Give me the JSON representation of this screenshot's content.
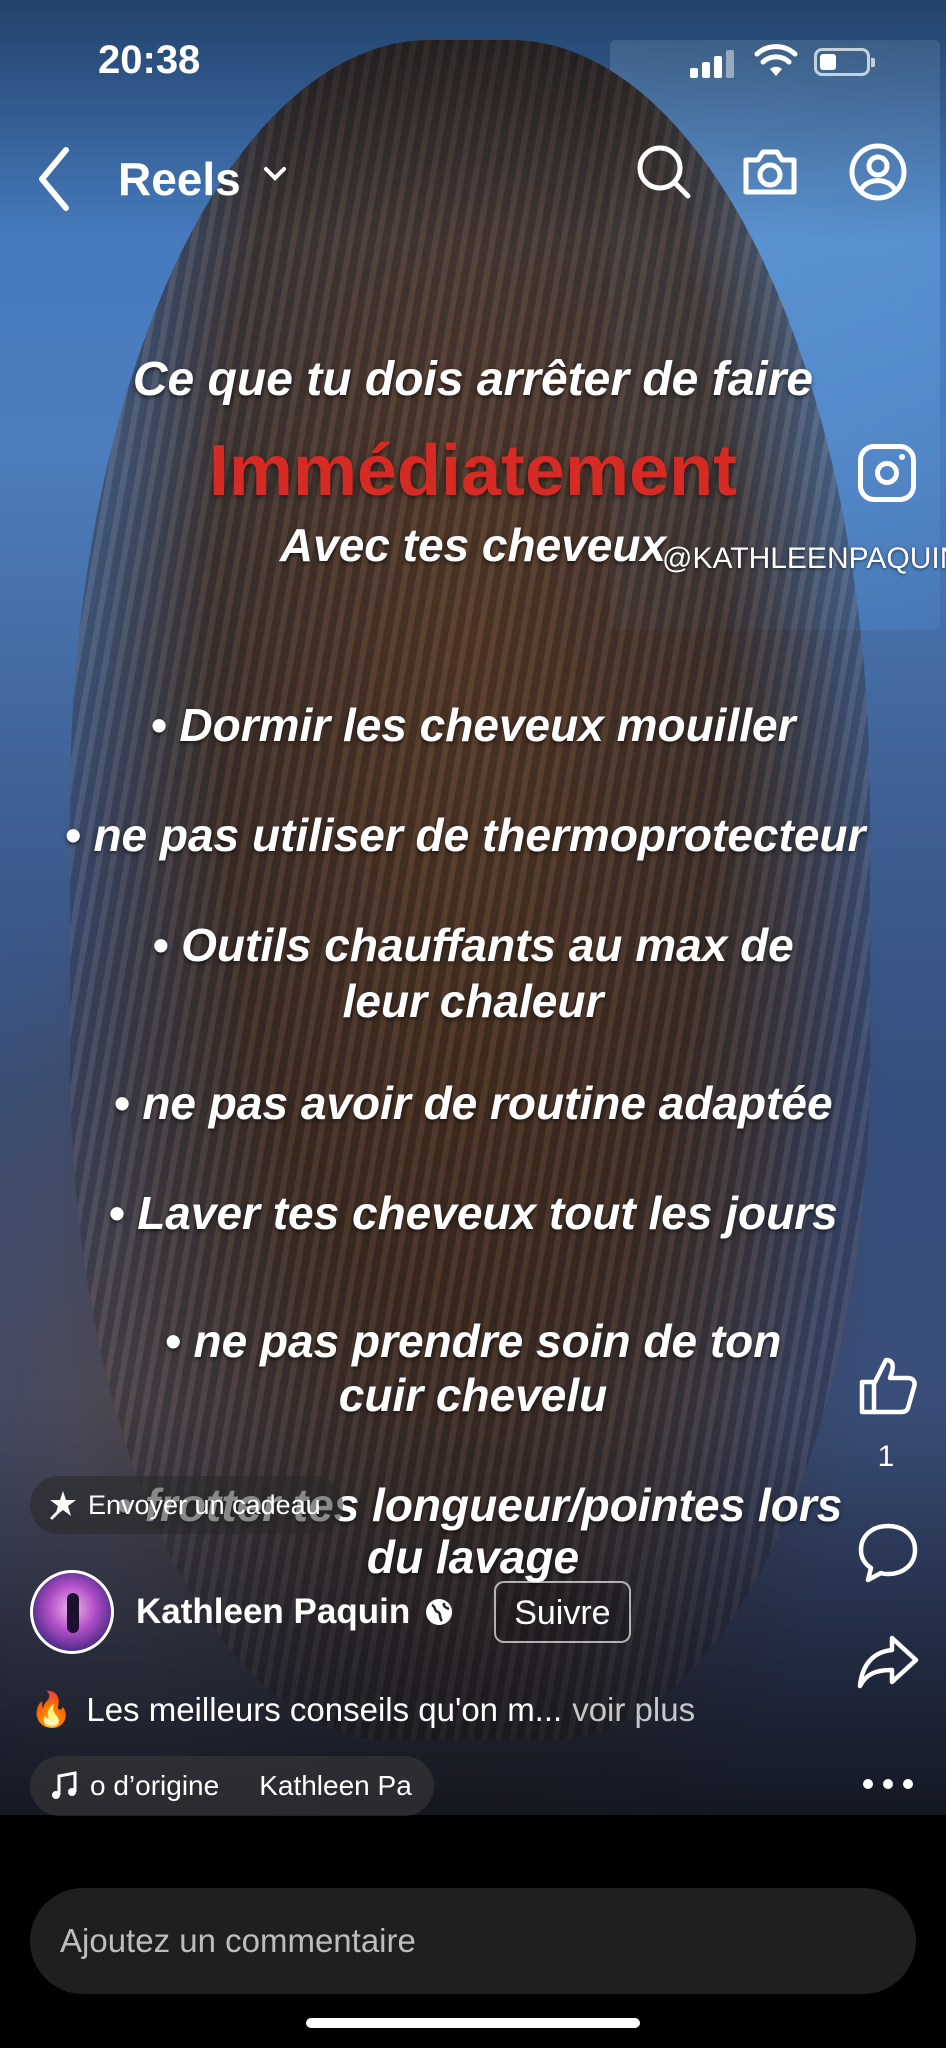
{
  "status_bar": {
    "time": "20:38"
  },
  "header": {
    "title": "Reels"
  },
  "overlay": {
    "title_line": "Ce que tu dois arrêter de faire",
    "highlight": "Immédiatement",
    "subtitle": "Avec tes cheveux",
    "handle": "@KATHLEENPAQUIN_",
    "bullets": [
      "• Dormir les cheveux mouiller",
      "• ne pas utiliser de thermoprotecteur",
      "• Outils chauffants au max de",
      "leur chaleur",
      "• ne pas avoir de routine adaptée",
      "• Laver tes cheveux tout les jours",
      "• ne pas prendre soin de ton",
      "cuir chevelu",
      "• frotter tes longueur/pointes lors",
      "du lavage"
    ]
  },
  "gift_button": "Envoyer un cadeau",
  "author": {
    "name": "Kathleen Paquin",
    "follow_label": "Suivre"
  },
  "caption": {
    "text": "Les meilleurs conseils qu'on m...",
    "more": "voir plus"
  },
  "audio": {
    "title": "o d’origine",
    "artist": "Kathleen Pa"
  },
  "actions": {
    "like_count": "1"
  },
  "comment": {
    "placeholder": "Ajoutez un commentaire"
  },
  "icons": {
    "back": "back-chevron-icon",
    "dropdown": "chevron-down-icon",
    "search": "search-icon",
    "camera": "camera-icon",
    "profile": "profile-icon",
    "like": "thumbs-up-icon",
    "comment": "comment-icon",
    "share": "share-icon",
    "more": "more-icon",
    "gift": "gift-icon",
    "music": "music-note-icon",
    "globe": "globe-icon",
    "instagram": "instagram-icon"
  }
}
